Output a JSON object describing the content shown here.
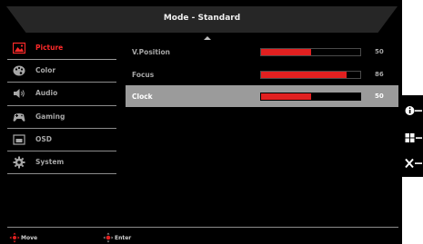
{
  "header": {
    "title": "Mode - Standard"
  },
  "sidebar": {
    "items": [
      {
        "label": "Picture",
        "icon": "picture-icon",
        "active": true
      },
      {
        "label": "Color",
        "icon": "color-icon",
        "active": false
      },
      {
        "label": "Audio",
        "icon": "audio-icon",
        "active": false
      },
      {
        "label": "Gaming",
        "icon": "gaming-icon",
        "active": false
      },
      {
        "label": "OSD",
        "icon": "osd-icon",
        "active": false
      },
      {
        "label": "System",
        "icon": "system-icon",
        "active": false
      }
    ]
  },
  "settings": [
    {
      "label": "V.Position",
      "value": "50",
      "level": 0.5,
      "selected": false
    },
    {
      "label": "Focus",
      "value": "86",
      "level": 0.86,
      "selected": false
    },
    {
      "label": "Clock",
      "value": "50",
      "level": 0.5,
      "selected": true
    }
  ],
  "footer": {
    "move_label": "Move",
    "enter_label": "Enter"
  },
  "keys": [
    {
      "name": "info-key",
      "icon": "info-icon"
    },
    {
      "name": "menu-key",
      "icon": "grid-icon"
    },
    {
      "name": "close-key",
      "icon": "close-icon"
    }
  ],
  "colors": {
    "accent": "#e12020",
    "selected_row": "#9b9b9b",
    "background": "#000000"
  }
}
